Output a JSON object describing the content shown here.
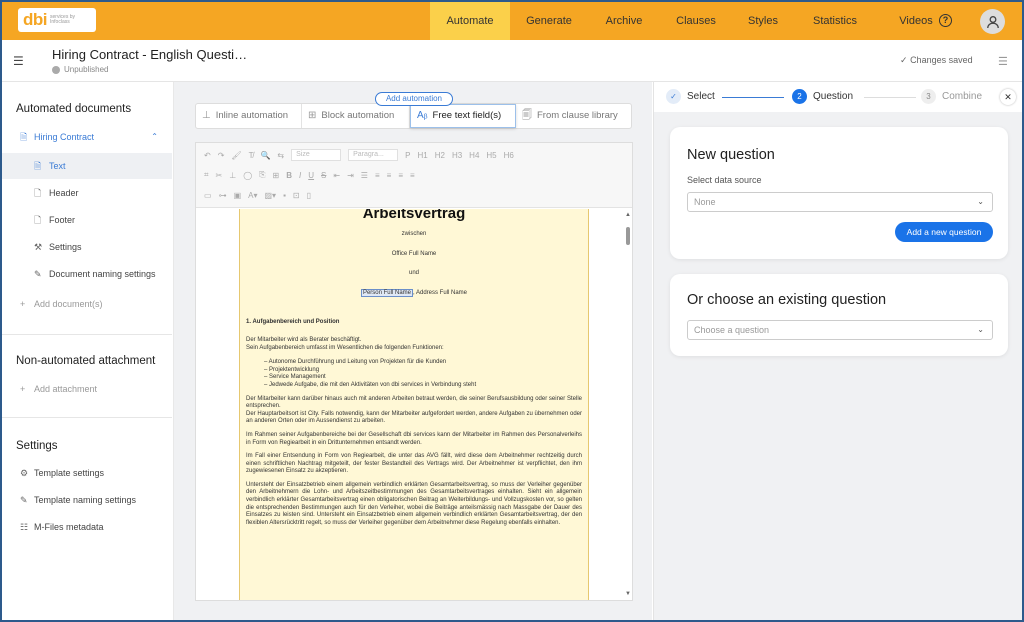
{
  "brand": {
    "logo_text": "dbi",
    "logo_sub": "services by Infoclass"
  },
  "nav": {
    "tabs": [
      {
        "label": "Automate",
        "active": true
      },
      {
        "label": "Generate"
      },
      {
        "label": "Archive"
      },
      {
        "label": "Clauses"
      },
      {
        "label": "Styles"
      },
      {
        "label": "Statistics"
      },
      {
        "label": "Videos"
      }
    ],
    "help_icon": "?"
  },
  "header": {
    "title": "Hiring Contract - English Questi…",
    "status": "Unpublished",
    "saved": "Changes saved"
  },
  "sidebar": {
    "automated_title": "Automated documents",
    "document": "Hiring Contract",
    "items": [
      {
        "label": "Text",
        "icon": "text-doc-icon"
      },
      {
        "label": "Header",
        "icon": "doc-icon"
      },
      {
        "label": "Footer",
        "icon": "doc-icon"
      },
      {
        "label": "Settings",
        "icon": "wrench-icon"
      },
      {
        "label": "Document naming settings",
        "icon": "edit-icon"
      }
    ],
    "add_document": "Add document(s)",
    "non_automated_title": "Non-automated attachment",
    "add_attachment": "Add attachment",
    "settings_title": "Settings",
    "settings_items": [
      {
        "label": "Template settings",
        "icon": "gear-icon"
      },
      {
        "label": "Template naming settings",
        "icon": "edit-icon"
      },
      {
        "label": "M-Files metadata",
        "icon": "list-icon"
      }
    ]
  },
  "automation": {
    "pill": "Add automation",
    "buttons": [
      "Inline automation",
      "Block automation",
      "Free text field(s)",
      "From clause library"
    ]
  },
  "toolbar": {
    "size_placeholder": "Size",
    "paragraph_placeholder": "Paragra...",
    "headings": [
      "P",
      "H1",
      "H2",
      "H3",
      "H4",
      "H5",
      "H6"
    ]
  },
  "document": {
    "heading": "Arbeitsvertrag",
    "zwischen": "zwischen",
    "office": "Office Full Name",
    "und": "und",
    "person": "Person Full Name",
    "address": ", Address Full Name",
    "section1_title": "1.      Aufgabenbereich und Position",
    "p1": "Der Mitarbeiter wird als Berater beschäftigt.",
    "p2": "Sein Aufgabenbereich umfasst im Wesentlichen die folgenden Funktionen:",
    "bullets": [
      "–      Autonome Durchführung und Leitung von Projekten für die Kunden",
      "–      Projektentwicklung",
      "–      Service Management",
      "–      Jedwede Aufgabe, die mit den Aktivitäten von dbi services in Verbindung steht"
    ],
    "p3": "Der Mitarbeiter kann darüber hinaus auch mit anderen Arbeiten betraut werden, die seiner Berufsausbildung oder seiner Stelle entsprechen.",
    "p4": "Der Hauptarbeitsort ist City. Falls notwendig, kann der Mitarbeiter aufgefordert werden, andere Aufgaben zu übernehmen oder an anderen Orten oder im Aussendienst zu arbeiten.",
    "p5": "Im Rahmen seiner Aufgabenbereiche bei der Gesellschaft dbi services kann der Mitarbeiter im Rahmen des Personalverleihs in Form von Regiearbeit in ein Drittunternehmen entsandt werden.",
    "p6": "Im Fall einer Entsendung in Form von Regiearbeit, die unter das AVG fällt, wird diese dem Arbeitnehmer rechtzeitig durch einen schriftlichen Nachtrag mitgeteilt, der fester Bestandteil des Vertrags wird. Der Arbeitnehmer ist verpflichtet, den ihm zugewiesenen Einsatz zu akzeptieren.",
    "p7": "Untersteht der Einsatzbetrieb einem allgemein verbindlich erklärten Gesamtarbeitsvertrag, so muss der Verleiher gegenüber den Arbeitnehmern die Lohn- und Arbeitszeitbestimmungen des Gesamtarbeitsvertrages einhalten. Sieht ein allgemein verbindlich erklärter Gesamtarbeitsvertrag einen obligatorischen Beitrag an Weiterbildungs- und Vollzugskosten vor, so gelten die entsprechenden Bestimmungen auch für den Verleiher, wobei die Beiträge anteilsmässig nach Massgabe der Dauer des Einsatzes zu leisten sind. Untersteht ein Einsatzbetrieb einem allgemein verbindlich erklärten Gesamtarbeitsvertrag, der den flexiblen Altersrücktritt regelt, so muss der Verleiher gegenüber dem Arbeitnehmer diese Regelung ebenfalls einhalten."
  },
  "stepper": {
    "steps": [
      {
        "num": "✓",
        "label": "Select"
      },
      {
        "num": "2",
        "label": "Question"
      },
      {
        "num": "3",
        "label": "Combine"
      }
    ]
  },
  "new_question": {
    "title": "New question",
    "source_label": "Select data source",
    "source_value": "None",
    "button": "Add a new question"
  },
  "existing": {
    "title": "Or choose an existing question",
    "placeholder": "Choose a question"
  },
  "colors": {
    "accent": "#f5a623",
    "active_tab": "#fbd04a",
    "primary": "#1a73e8",
    "doc_bg": "#fff8d6"
  }
}
